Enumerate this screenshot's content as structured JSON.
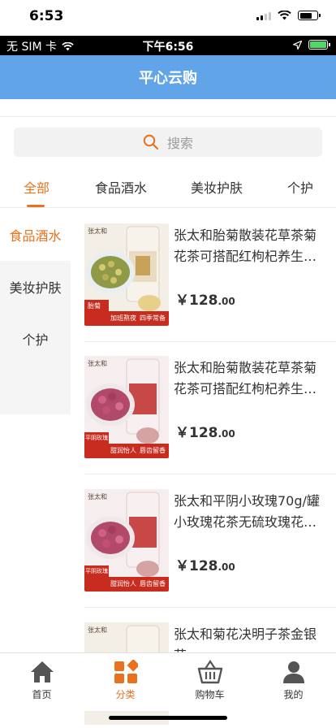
{
  "ios_status": {
    "time": "6:53"
  },
  "inner_status": {
    "carrier": "无 SIM 卡",
    "time": "下午6:56"
  },
  "header": {
    "title": "平心云购"
  },
  "search": {
    "placeholder": "搜索"
  },
  "tabs": [
    {
      "label": "全部",
      "active": true
    },
    {
      "label": "食品酒水",
      "active": false
    },
    {
      "label": "美妆护肤",
      "active": false
    },
    {
      "label": "个护",
      "active": false
    }
  ],
  "side_menu": [
    {
      "label": "食品酒水",
      "active": true
    },
    {
      "label": "美妆护肤",
      "active": false
    },
    {
      "label": "个护",
      "active": false
    }
  ],
  "products": [
    {
      "title": "张太和胎菊散装花草茶菊花茶可搭配红枸杞养生茶饮...",
      "price_int": "￥128",
      "price_dec": ".00",
      "image": {
        "brand": "张太和",
        "name_tag": "胎菊",
        "badges": [
          "加班熬夜",
          "四季常备"
        ],
        "theme": "chrysanthemum"
      }
    },
    {
      "title": "张太和胎菊散装花草茶菊花茶可搭配红枸杞养生茶饮...",
      "price_int": "￥128",
      "price_dec": ".00",
      "image": {
        "brand": "张太和",
        "name_tag": "平阴玫瑰",
        "badges": [
          "甜润怡人",
          "唇齿留香"
        ],
        "theme": "rose"
      }
    },
    {
      "title": "张太和平阴小玫瑰70g/罐小玫瑰花茶无硫玫瑰花茶泡...",
      "price_int": "￥128",
      "price_dec": ".00",
      "image": {
        "brand": "张太和",
        "name_tag": "平阴玫瑰",
        "badges": [
          "甜润怡人",
          "唇齿留香"
        ],
        "theme": "rose"
      }
    },
    {
      "title": "张太和菊花决明子茶金银花",
      "price_int": "",
      "price_dec": "",
      "image": {
        "brand": "张太和",
        "name_tag": "",
        "badges": [],
        "theme": "chrysanthemum"
      }
    }
  ],
  "tabbar": [
    {
      "label": "首页",
      "icon": "home-icon",
      "active": false
    },
    {
      "label": "分类",
      "icon": "category-icon",
      "active": true
    },
    {
      "label": "购物车",
      "icon": "cart-icon",
      "active": false
    },
    {
      "label": "我的",
      "icon": "user-icon",
      "active": false
    }
  ],
  "colors": {
    "accent": "#e8721d",
    "header_bg": "#61a5e8",
    "inactive_icon": "#555555"
  }
}
